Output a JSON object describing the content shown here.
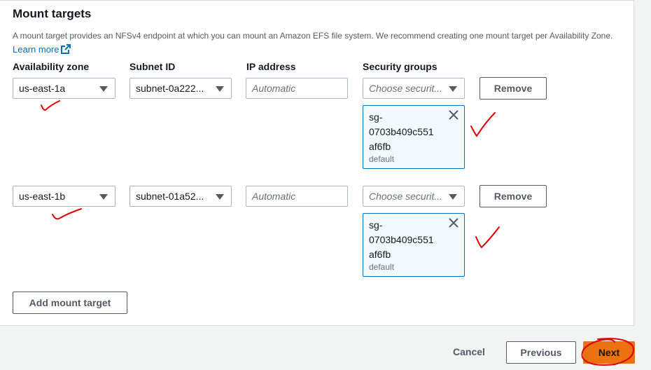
{
  "section": {
    "title": "Mount targets",
    "description": "A mount target provides an NFSv4 endpoint at which you can mount an Amazon EFS file system. We recommend creating one mount target per Availability Zone.",
    "learn_more": "Learn more",
    "columns": {
      "az": "Availability zone",
      "subnet": "Subnet ID",
      "ip": "IP address",
      "sg": "Security groups"
    }
  },
  "rows": [
    {
      "az": "us-east-1a",
      "subnet": "subnet-0a222...",
      "ip_placeholder": "Automatic",
      "sg_placeholder": "Choose securit...",
      "remove": "Remove",
      "token": {
        "line1": "sg-",
        "line2": "0703b409c551",
        "line3": "af6fb",
        "sub": "default"
      }
    },
    {
      "az": "us-east-1b",
      "subnet": "subnet-01a52...",
      "ip_placeholder": "Automatic",
      "sg_placeholder": "Choose securit...",
      "remove": "Remove",
      "token": {
        "line1": "sg-",
        "line2": "0703b409c551",
        "line3": "af6fb",
        "sub": "default"
      }
    }
  ],
  "add_button": "Add mount target",
  "footer": {
    "cancel": "Cancel",
    "previous": "Previous",
    "next": "Next"
  },
  "colors": {
    "accent": "#ec7211",
    "link": "#0073bb",
    "annotation": "#e00000"
  }
}
